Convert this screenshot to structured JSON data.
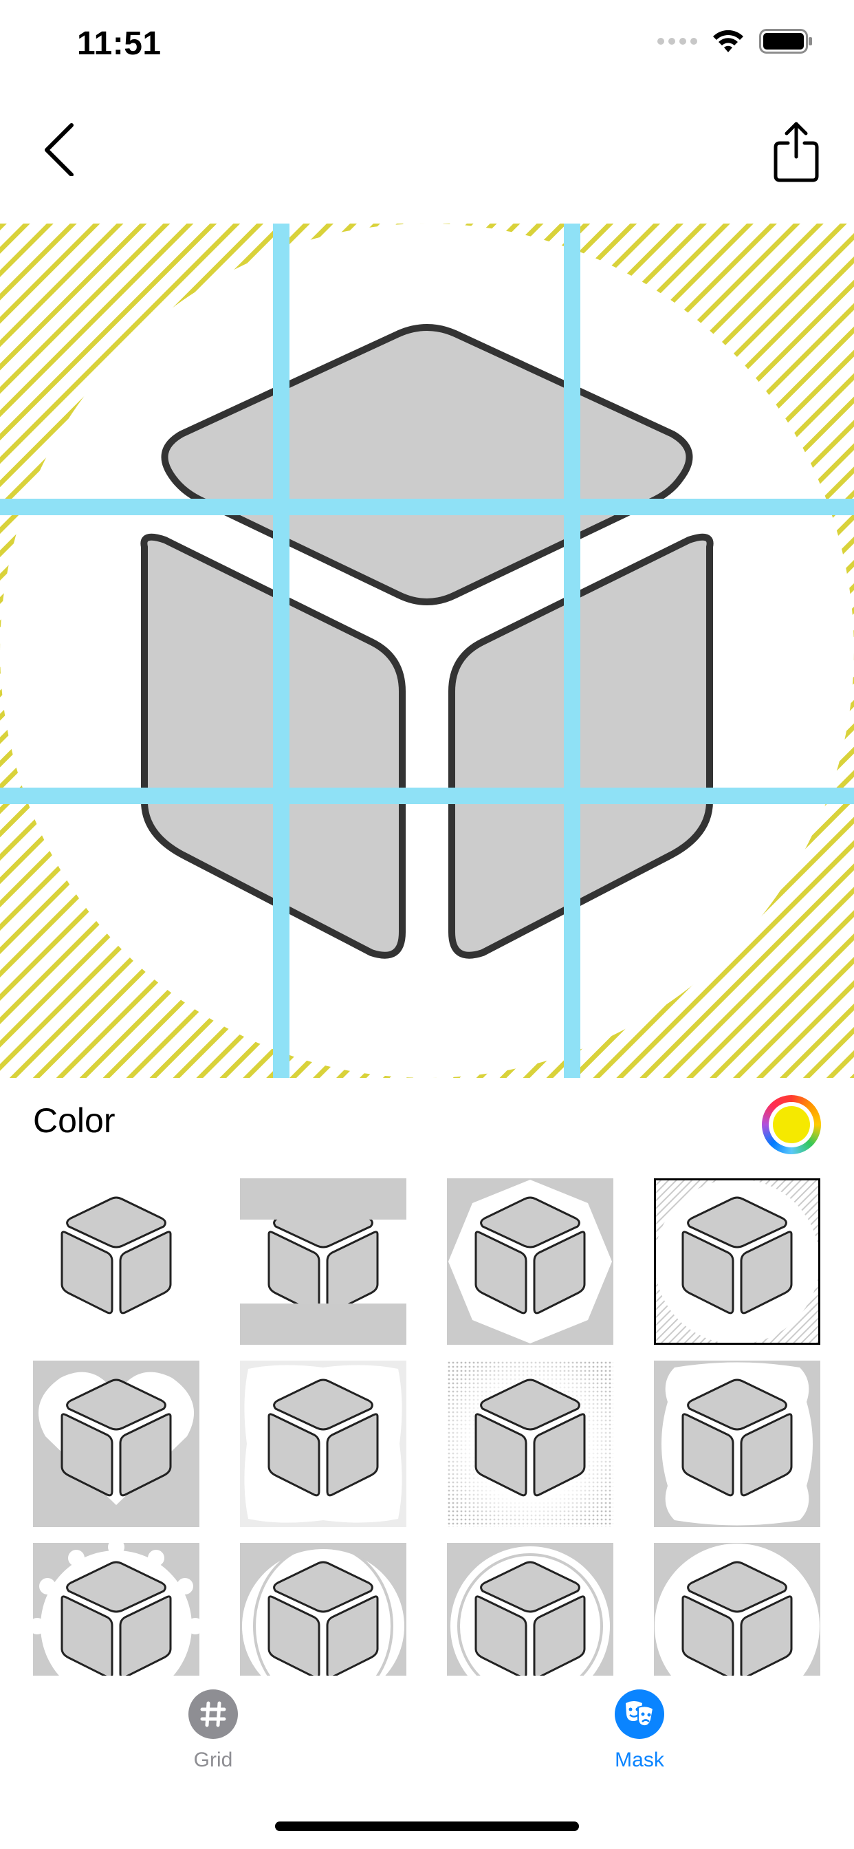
{
  "status_bar": {
    "time": "11:51"
  },
  "nav": {
    "back_icon": "chevron-left-icon",
    "share_icon": "share-icon"
  },
  "editor": {
    "mask_color": "#d9d23a",
    "grid_line_color": "#8fe1f6",
    "shape_fill": "#cccccc",
    "shape_stroke": "#333333"
  },
  "color_section": {
    "label": "Color",
    "selected_color": "#f5e900"
  },
  "mask_options": [
    {
      "name": "none"
    },
    {
      "name": "bars"
    },
    {
      "name": "octagon"
    },
    {
      "name": "circle-stripes",
      "selected": true
    },
    {
      "name": "heart"
    },
    {
      "name": "wavy-square"
    },
    {
      "name": "dotted-fade"
    },
    {
      "name": "scalloped-square"
    },
    {
      "name": "gear"
    },
    {
      "name": "ellipses"
    },
    {
      "name": "double-circle"
    },
    {
      "name": "circle"
    }
  ],
  "tabs": [
    {
      "label": "Grid",
      "icon": "grid-icon",
      "active": false
    },
    {
      "label": "Mask",
      "icon": "masks-icon",
      "active": true
    }
  ]
}
